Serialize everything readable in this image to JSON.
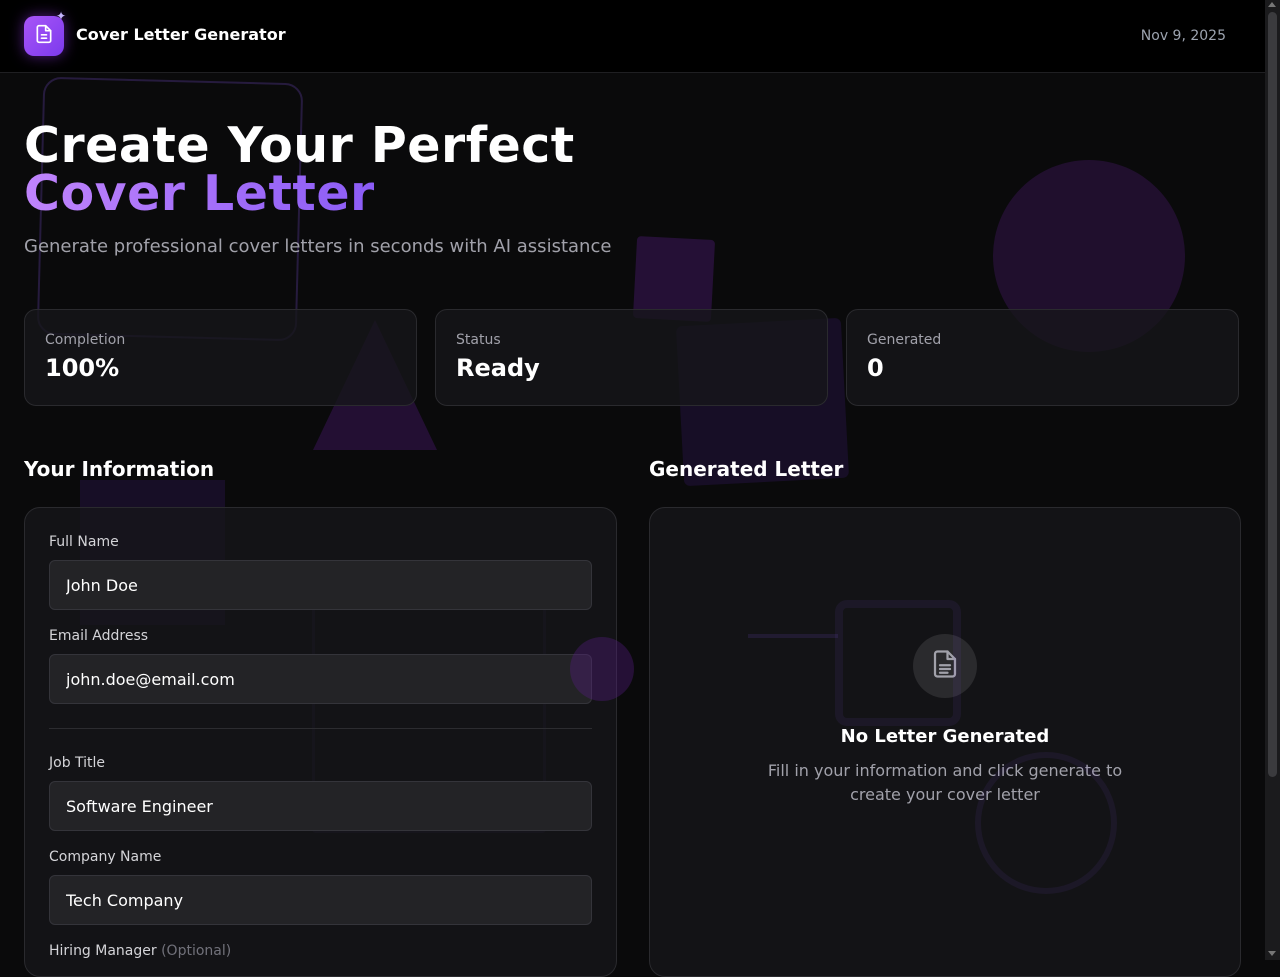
{
  "header": {
    "app_title": "Cover Letter Generator",
    "date": "Nov 9, 2025",
    "logo_icon": "document-icon",
    "sparkle_icon": "sparkles-icon"
  },
  "hero": {
    "title_line1": "Create Your Perfect",
    "title_line2": "Cover Letter",
    "subtitle": "Generate professional cover letters in seconds with AI assistance"
  },
  "stats": [
    {
      "label": "Completion",
      "value": "100%"
    },
    {
      "label": "Status",
      "value": "Ready"
    },
    {
      "label": "Generated",
      "value": "0"
    }
  ],
  "form": {
    "section_title": "Your Information",
    "fields": [
      {
        "label": "Full Name",
        "value": "John Doe"
      },
      {
        "label": "Email Address",
        "value": "john.doe@email.com"
      },
      {
        "label": "Job Title",
        "value": "Software Engineer"
      },
      {
        "label": "Company Name",
        "value": "Tech Company"
      },
      {
        "label": "Hiring Manager",
        "optional": "(Optional)"
      }
    ]
  },
  "letter": {
    "section_title": "Generated Letter",
    "empty_title": "No Letter Generated",
    "empty_text": "Fill in your information and click generate to create your cover letter",
    "empty_icon": "document-icon"
  },
  "colors": {
    "background": "#0a0a0b",
    "accent": "#a855f7",
    "accent_secondary": "#8b5cf6"
  }
}
